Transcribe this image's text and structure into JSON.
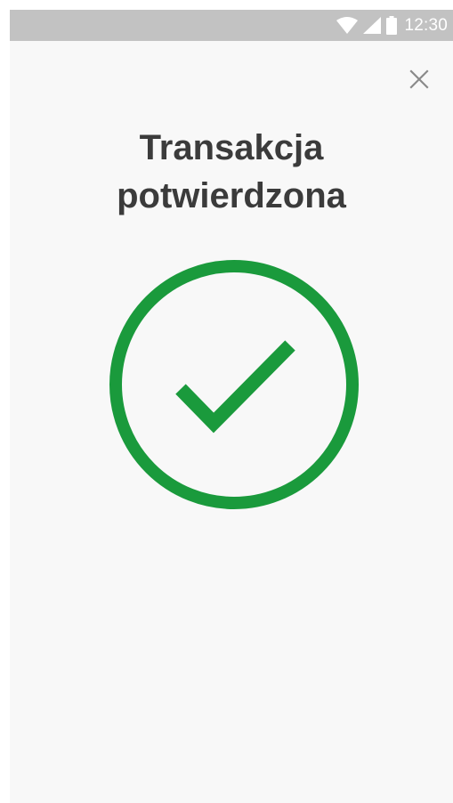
{
  "status_bar": {
    "time": "12:30",
    "icons": [
      "wifi-icon",
      "cellular-signal-icon",
      "battery-icon"
    ]
  },
  "dialog": {
    "close_icon": "close-icon",
    "title_line1": "Transakcja",
    "title_line2": "potwierdzona",
    "status_icon": "check-circle-icon"
  },
  "colors": {
    "success_green": "#1a9a3c",
    "status_bar": "#c2c2c2",
    "background": "#f8f8f8",
    "title_text": "#3b3b3b",
    "close_icon": "#8a8a8a"
  }
}
